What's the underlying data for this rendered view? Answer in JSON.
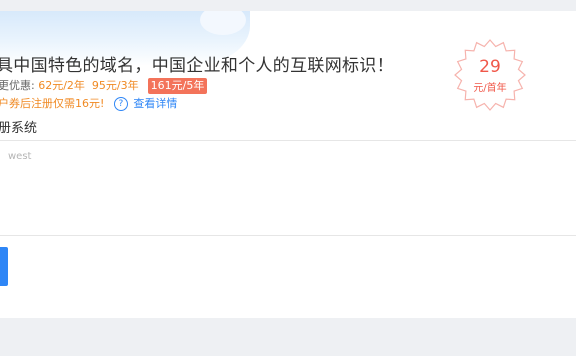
{
  "headline": "具中国特色的域名，中国企业和个人的互联网标识！",
  "pricing": {
    "label": "更优惠:",
    "price_2yr": "62元/2年",
    "price_3yr": "95元/3年",
    "price_5yr": "161元/5年"
  },
  "coupon": {
    "text": "户券后注册仅需16元!",
    "help_icon": "?",
    "detail_link": "查看详情"
  },
  "register_title": "册系统",
  "badge": {
    "price": "29",
    "unit": "元/首年"
  },
  "domain_input": {
    "placeholder": "west",
    "value": ""
  },
  "colors": {
    "accent_blue": "#2e86f6",
    "orange": "#f08a24",
    "badge_red": "#f0584a",
    "highlight_bg": "#f3735a"
  }
}
